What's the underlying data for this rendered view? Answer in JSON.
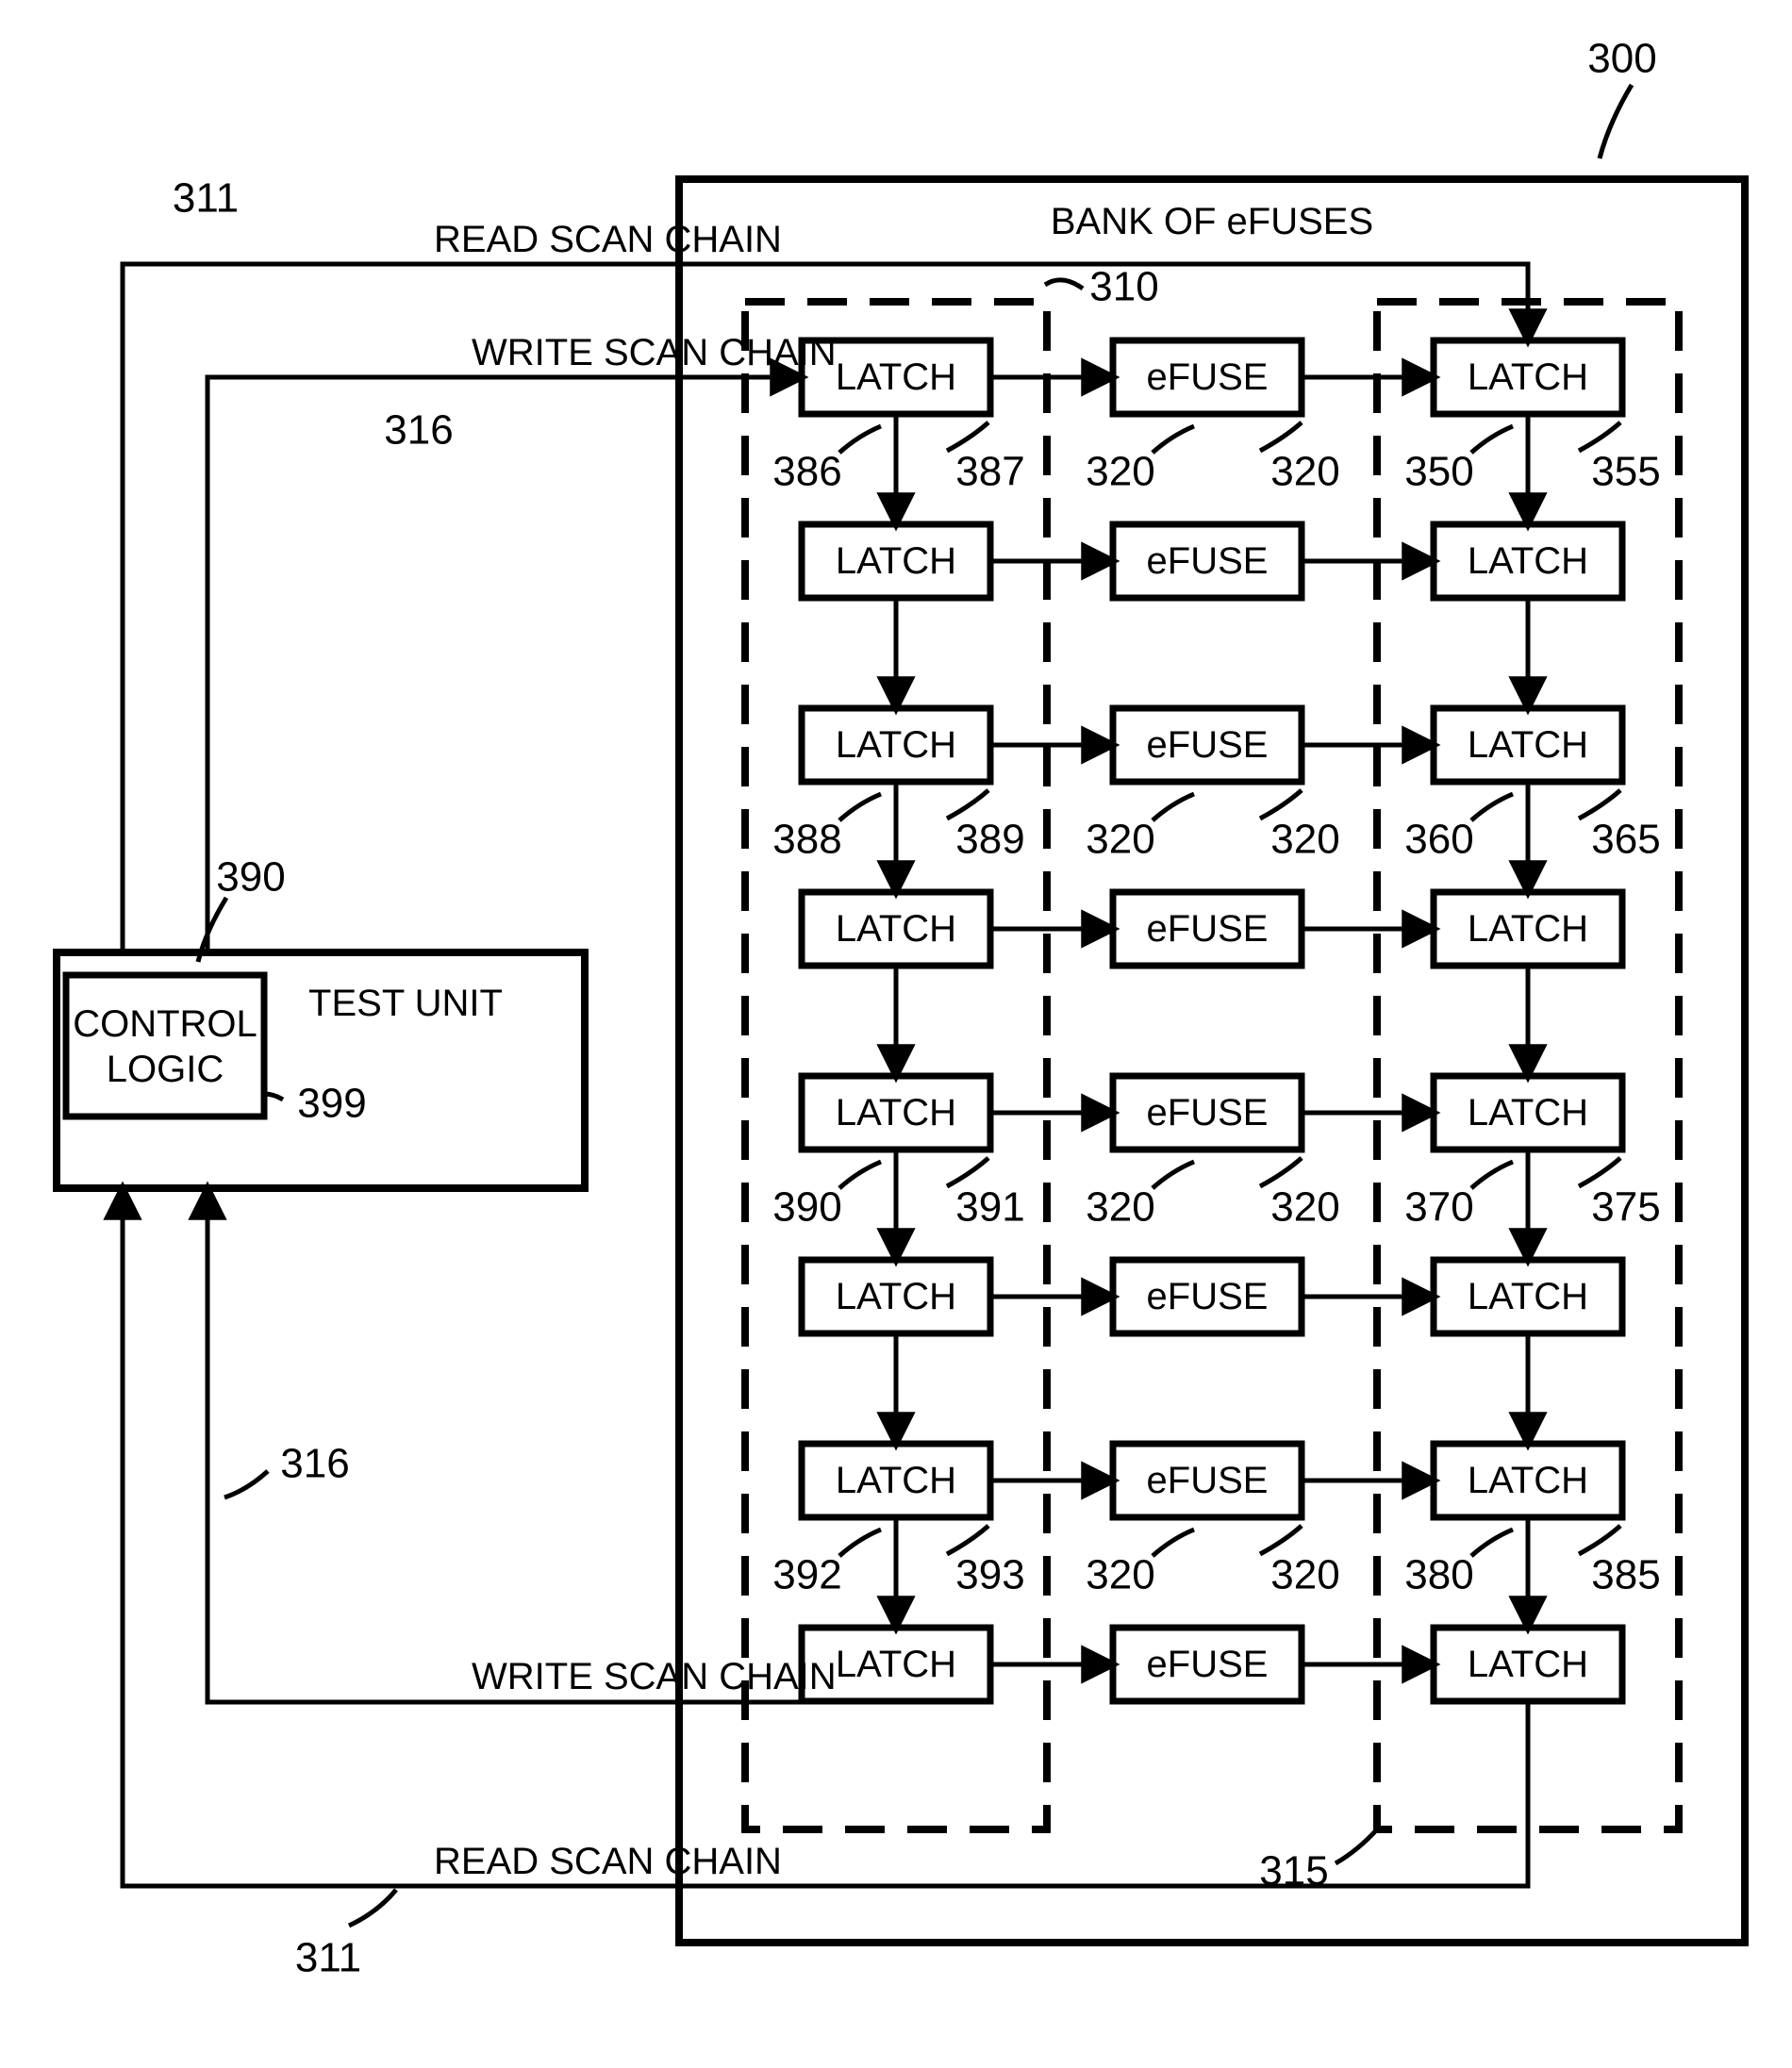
{
  "bank_title": "BANK OF eFUSES",
  "test_unit_title": "TEST UNIT",
  "control_logic_title": "CONTROL\nLOGIC",
  "labels": {
    "read_scan_chain": "READ SCAN CHAIN",
    "write_scan_chain": "WRITE SCAN CHAIN"
  },
  "rows": [
    {
      "left": "LATCH",
      "mid": "eFUSE",
      "right": "LATCH",
      "refs": {
        "left_wire": "386",
        "left_elem": "387",
        "mid_wire": "320",
        "mid_elem": "320",
        "right_wire": "350",
        "right_elem": "355"
      }
    },
    {
      "left": "LATCH",
      "mid": "eFUSE",
      "right": "LATCH",
      "refs": {}
    },
    {
      "left": "LATCH",
      "mid": "eFUSE",
      "right": "LATCH",
      "refs": {
        "left_wire": "388",
        "left_elem": "389",
        "mid_wire": "320",
        "mid_elem": "320",
        "right_wire": "360",
        "right_elem": "365"
      }
    },
    {
      "left": "LATCH",
      "mid": "eFUSE",
      "right": "LATCH",
      "refs": {}
    },
    {
      "left": "LATCH",
      "mid": "eFUSE",
      "right": "LATCH",
      "refs": {
        "left_wire": "390",
        "left_elem": "391",
        "mid_wire": "320",
        "mid_elem": "320",
        "right_wire": "370",
        "right_elem": "375"
      }
    },
    {
      "left": "LATCH",
      "mid": "eFUSE",
      "right": "LATCH",
      "refs": {}
    },
    {
      "left": "LATCH",
      "mid": "eFUSE",
      "right": "LATCH",
      "refs": {
        "left_wire": "392",
        "left_elem": "393",
        "mid_wire": "320",
        "mid_elem": "320",
        "right_wire": "380",
        "right_elem": "385"
      }
    },
    {
      "left": "LATCH",
      "mid": "eFUSE",
      "right": "LATCH",
      "refs": {}
    }
  ],
  "refs": {
    "bank": "300",
    "read_scan_chain_top": "311",
    "read_scan_chain_bottom": "311",
    "write_scan_chain_top": "316",
    "write_scan_chain_bottom": "316",
    "left_dashed_group": "310",
    "right_dashed_group": "315",
    "test_unit": "390",
    "control_logic": "399"
  }
}
